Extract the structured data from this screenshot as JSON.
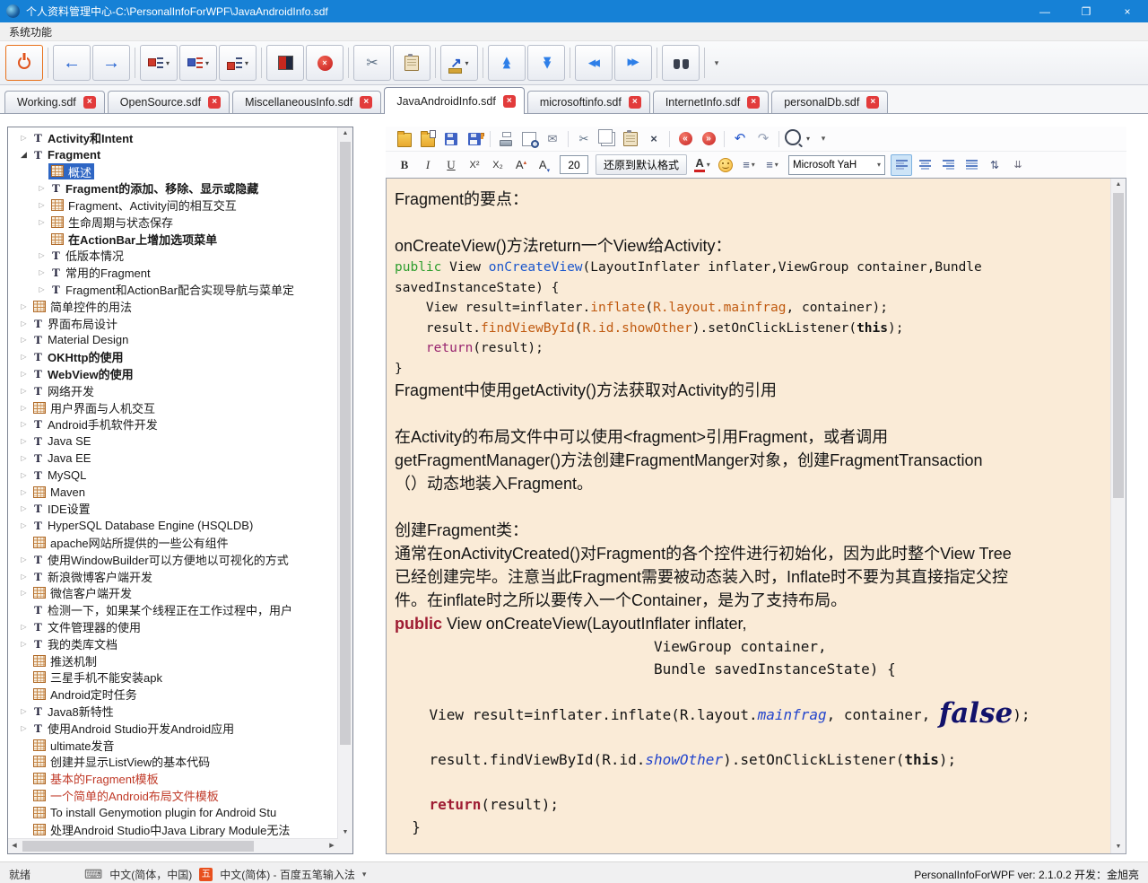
{
  "window": {
    "title": "个人资料管理中心-C:\\PersonalInfoForWPF\\JavaAndroidInfo.sdf",
    "menu": [
      "系统功能"
    ],
    "controls": {
      "minimize": "—",
      "maximize": "❐",
      "close": "×"
    }
  },
  "colors": {
    "titlebar": "#1681D6",
    "editor_background": "#FAEBD7",
    "tree_selection": "#2E66C4",
    "tab_close_red": "#E23B3B",
    "tree_red_item": "#C03A28"
  },
  "toolbar": {
    "groups": [
      [
        {
          "name": "power-button",
          "icon": "power",
          "cls": "power"
        }
      ],
      [
        {
          "name": "back-button",
          "icon": "arrow-left",
          "glyph": "←"
        },
        {
          "name": "forward-button",
          "icon": "arrow-right",
          "glyph": "→"
        }
      ],
      [
        {
          "name": "tree-style-dropdown",
          "icon": "tree1",
          "dropdown": true
        },
        {
          "name": "tree-expand-dropdown",
          "icon": "tree2",
          "dropdown": true
        },
        {
          "name": "tree-collapse-dropdown",
          "icon": "tree3",
          "dropdown": true
        }
      ],
      [
        {
          "name": "mark-node-button",
          "icon": "flag"
        },
        {
          "name": "delete-node-button",
          "icon": "stop",
          "glyph": "×"
        }
      ],
      [
        {
          "name": "cut-node-button",
          "icon": "scissors",
          "glyph": "✂"
        },
        {
          "name": "paste-node-button",
          "icon": "clipboard"
        }
      ],
      [
        {
          "name": "export-button",
          "icon": "export",
          "glyph": "↗",
          "dropdown": true
        }
      ],
      [
        {
          "name": "move-up-button",
          "icon": "double-up",
          "glyph": "▶▶"
        },
        {
          "name": "move-down-button",
          "icon": "double-down",
          "glyph": "▶▶"
        }
      ],
      [
        {
          "name": "prev-node-button",
          "icon": "double-left",
          "glyph": "▶▶"
        },
        {
          "name": "next-node-button",
          "icon": "double-right",
          "glyph": "▶▶"
        }
      ],
      [
        {
          "name": "search-button",
          "icon": "binoculars"
        }
      ],
      [
        {
          "name": "toolbar-overflow-button",
          "icon": "overflow",
          "glyph": "▾",
          "flat": true
        }
      ]
    ]
  },
  "tabs": [
    {
      "label": "Working.sdf",
      "active": false
    },
    {
      "label": "OpenSource.sdf",
      "active": false
    },
    {
      "label": "MiscellaneousInfo.sdf",
      "active": false
    },
    {
      "label": "JavaAndroidInfo.sdf",
      "active": true
    },
    {
      "label": "microsoftinfo.sdf",
      "active": false
    },
    {
      "label": "InternetInfo.sdf",
      "active": false
    },
    {
      "label": "personalDb.sdf",
      "active": false
    }
  ],
  "tree": {
    "items": [
      {
        "label": "Activity和Intent",
        "icon": "T",
        "lvl": 0,
        "ar": "c",
        "b": true
      },
      {
        "label": "Fragment",
        "icon": "T",
        "lvl": 0,
        "ar": "e",
        "b": true
      },
      {
        "label": "概述",
        "icon": "g",
        "lvl": 1,
        "ar": "n",
        "sel": true
      },
      {
        "label": "Fragment的添加、移除、显示或隐藏",
        "icon": "T",
        "lvl": 1,
        "ar": "c",
        "b": true
      },
      {
        "label": "Fragment、Activity间的相互交互",
        "icon": "g",
        "lvl": 1,
        "ar": "c"
      },
      {
        "label": "生命周期与状态保存",
        "icon": "g",
        "lvl": 1,
        "ar": "c"
      },
      {
        "label": "在ActionBar上增加选项菜单",
        "icon": "g",
        "lvl": 1,
        "ar": "n",
        "b": true
      },
      {
        "label": "低版本情况",
        "icon": "T",
        "lvl": 1,
        "ar": "c"
      },
      {
        "label": "常用的Fragment",
        "icon": "T",
        "lvl": 1,
        "ar": "c"
      },
      {
        "label": "Fragment和ActionBar配合实现导航与菜单定",
        "icon": "T",
        "lvl": 1,
        "ar": "c"
      },
      {
        "label": "简单控件的用法",
        "icon": "g",
        "lvl": 0,
        "ar": "c"
      },
      {
        "label": "界面布局设计",
        "icon": "T",
        "lvl": 0,
        "ar": "c"
      },
      {
        "label": "Material Design",
        "icon": "T",
        "lvl": 0,
        "ar": "c"
      },
      {
        "label": "OKHttp的使用",
        "icon": "T",
        "lvl": 0,
        "ar": "c",
        "b": true
      },
      {
        "label": "WebView的使用",
        "icon": "T",
        "lvl": 0,
        "ar": "c",
        "b": true
      },
      {
        "label": "网络开发",
        "icon": "T",
        "lvl": 0,
        "ar": "c"
      },
      {
        "label": "用户界面与人机交互",
        "icon": "g",
        "lvl": 0,
        "ar": "c"
      },
      {
        "label": "Android手机软件开发",
        "icon": "T",
        "lvl": 0,
        "ar": "c"
      },
      {
        "label": "Java SE",
        "icon": "T",
        "lvl": 0,
        "ar": "c"
      },
      {
        "label": "Java EE",
        "icon": "T",
        "lvl": 0,
        "ar": "c"
      },
      {
        "label": "MySQL",
        "icon": "T",
        "lvl": 0,
        "ar": "c"
      },
      {
        "label": "Maven",
        "icon": "g",
        "lvl": 0,
        "ar": "c"
      },
      {
        "label": "IDE设置",
        "icon": "T",
        "lvl": 0,
        "ar": "c"
      },
      {
        "label": "HyperSQL Database Engine (HSQLDB)",
        "icon": "T",
        "lvl": 0,
        "ar": "c"
      },
      {
        "label": "apache网站所提供的一些公有组件",
        "icon": "g",
        "lvl": 0,
        "ar": "n"
      },
      {
        "label": "使用WindowBuilder可以方便地以可视化的方式",
        "icon": "T",
        "lvl": 0,
        "ar": "c"
      },
      {
        "label": "新浪微博客户端开发",
        "icon": "T",
        "lvl": 0,
        "ar": "c"
      },
      {
        "label": "微信客户端开发",
        "icon": "g",
        "lvl": 0,
        "ar": "c"
      },
      {
        "label": "检测一下，如果某个线程正在工作过程中，用户",
        "icon": "T",
        "lvl": 0,
        "ar": "n"
      },
      {
        "label": "文件管理器的使用",
        "icon": "T",
        "lvl": 0,
        "ar": "c"
      },
      {
        "label": "我的类库文档",
        "icon": "T",
        "lvl": 0,
        "ar": "c"
      },
      {
        "label": "推送机制",
        "icon": "g",
        "lvl": 0,
        "ar": "n"
      },
      {
        "label": "三星手机不能安装apk",
        "icon": "g",
        "lvl": 0,
        "ar": "n"
      },
      {
        "label": "Android定时任务",
        "icon": "g",
        "lvl": 0,
        "ar": "n"
      },
      {
        "label": "Java8新特性",
        "icon": "T",
        "lvl": 0,
        "ar": "c"
      },
      {
        "label": "使用Android Studio开发Android应用",
        "icon": "T",
        "lvl": 0,
        "ar": "c"
      },
      {
        "label": "ultimate发音",
        "icon": "g",
        "lvl": 0,
        "ar": "n"
      },
      {
        "label": "创建并显示ListView的基本代码",
        "icon": "g",
        "lvl": 0,
        "ar": "n"
      },
      {
        "label": "基本的Fragment模板",
        "icon": "g",
        "lvl": 0,
        "ar": "n",
        "red": true
      },
      {
        "label": "一个简单的Android布局文件模板",
        "icon": "g",
        "lvl": 0,
        "ar": "n",
        "red": true
      },
      {
        "label": "To install Genymotion plugin for Android Stu",
        "icon": "g",
        "lvl": 0,
        "ar": "n"
      },
      {
        "label": "处理Android Studio中Java Library Module无法",
        "icon": "g",
        "lvl": 0,
        "ar": "n"
      }
    ]
  },
  "editor": {
    "toolbar1": {
      "groups": [
        [
          {
            "name": "open-button",
            "icon": "folder-open"
          },
          {
            "name": "open-in-window-button",
            "icon": "folder-doc"
          },
          {
            "name": "save-button",
            "icon": "floppy"
          },
          {
            "name": "save-as-button",
            "icon": "floppy-edit"
          }
        ],
        [
          {
            "name": "print-button",
            "icon": "printer"
          },
          {
            "name": "print-preview-button",
            "icon": "preview"
          },
          {
            "name": "email-button",
            "icon": "envelope",
            "glyph": "✉"
          }
        ],
        [
          {
            "name": "cut-button",
            "icon": "scissors-sm",
            "glyph": "✂"
          },
          {
            "name": "copy-button",
            "icon": "copy-pages"
          },
          {
            "name": "paste-button",
            "icon": "clipboard-sm"
          },
          {
            "name": "delete-button",
            "icon": "delete-x",
            "glyph": "×"
          }
        ],
        [
          {
            "name": "nav-first-button",
            "icon": "red-first",
            "glyph": "«"
          },
          {
            "name": "nav-last-button",
            "icon": "red-last",
            "glyph": "»"
          }
        ],
        [
          {
            "name": "undo-button",
            "icon": "undo",
            "glyph": "↶"
          },
          {
            "name": "redo-button",
            "icon": "redo",
            "glyph": "↷"
          }
        ],
        [
          {
            "name": "zoom-button",
            "icon": "magnifier",
            "dropdown": true
          },
          {
            "name": "editor-toolbar-overflow-button",
            "icon": "overflow",
            "glyph": "▾",
            "flat": true
          }
        ]
      ]
    },
    "toolbar2": {
      "bold": "B",
      "italic": "I",
      "underline": "U",
      "superscript": "X²",
      "subscript": "X₂",
      "grow_font": "A",
      "shrink_font": "A",
      "font_size": "20",
      "restore_format": "还原到默认格式",
      "font_color": "A",
      "font_family": "Microsoft YaH"
    },
    "content": {
      "lines": [
        {
          "f": "s",
          "seg": [
            [
              "Fragment的要点：",
              ""
            ]
          ]
        },
        {
          "f": "s",
          "seg": []
        },
        {
          "f": "s",
          "seg": [
            [
              "onCreateView()方法return一个View给Activity：",
              ""
            ]
          ]
        },
        {
          "f": "c1",
          "seg": [
            [
              "public",
              "kg"
            ],
            [
              " View ",
              ""
            ],
            [
              "onCreateView",
              "kb"
            ],
            [
              "(LayoutInflater inflater,ViewGroup container,Bundle",
              ""
            ]
          ]
        },
        {
          "f": "c1",
          "seg": [
            [
              "savedInstanceState) {",
              ""
            ]
          ]
        },
        {
          "f": "c1",
          "seg": [
            [
              "    View result=inflater.",
              ""
            ],
            [
              "inflate",
              "ko"
            ],
            [
              "(",
              ""
            ],
            [
              "R.layout.mainfrag",
              "ko"
            ],
            [
              ", container);",
              ""
            ]
          ]
        },
        {
          "f": "c1",
          "seg": [
            [
              "    result.",
              ""
            ],
            [
              "findViewById",
              "ko"
            ],
            [
              "(",
              ""
            ],
            [
              "R.id.showOther",
              "ko"
            ],
            [
              ").setOnClickListener(",
              ""
            ],
            [
              "this",
              "kbd"
            ],
            [
              ");",
              ""
            ]
          ]
        },
        {
          "f": "c1",
          "seg": [
            [
              "    ",
              ""
            ],
            [
              "return",
              "km"
            ],
            [
              "(result);",
              ""
            ]
          ]
        },
        {
          "f": "c1",
          "seg": [
            [
              "}",
              ""
            ]
          ]
        },
        {
          "f": "s",
          "seg": [
            [
              "Fragment中使用getActivity()方法获取对Activity的引用",
              ""
            ]
          ]
        },
        {
          "f": "s",
          "seg": []
        },
        {
          "f": "s",
          "seg": [
            [
              "在Activity的布局文件中可以使用<fragment>引用Fragment，或者调用",
              ""
            ]
          ]
        },
        {
          "f": "s",
          "seg": [
            [
              "getFragmentManager()方法创建FragmentManger对象，创建FragmentTransaction",
              ""
            ]
          ]
        },
        {
          "f": "s",
          "seg": [
            [
              "（）动态地装入Fragment。",
              ""
            ]
          ]
        },
        {
          "f": "s",
          "seg": []
        },
        {
          "f": "s",
          "seg": [
            [
              "创建Fragment类：",
              ""
            ]
          ]
        },
        {
          "f": "s",
          "seg": [
            [
              "通常在onActivityCreated()对Fragment的各个控件进行初始化，因为此时整个View Tree",
              ""
            ]
          ]
        },
        {
          "f": "s",
          "seg": [
            [
              "已经创建完毕。注意当此Fragment需要被动态装入时，Inflate时不要为其直接指定父控",
              ""
            ]
          ]
        },
        {
          "f": "s",
          "seg": [
            [
              "件。在inflate时之所以要传入一个Container，是为了支持布局。",
              ""
            ]
          ]
        },
        {
          "f": "s",
          "seg": [
            [
              "public",
              "kw2"
            ],
            [
              " View onCreateView(LayoutInflater inflater,",
              ""
            ]
          ]
        },
        {
          "f": "c2",
          "seg": [
            [
              "                              ViewGroup container,",
              ""
            ]
          ]
        },
        {
          "f": "c2",
          "seg": [
            [
              "                              Bundle savedInstanceState) {",
              ""
            ]
          ]
        },
        {
          "f": "c2",
          "seg": []
        },
        {
          "f": "c2",
          "seg": [
            [
              "    View result=inflater.inflate(R.layout.",
              ""
            ],
            [
              "mainfrag",
              "kit"
            ],
            [
              ", container, ",
              ""
            ],
            [
              "false",
              "kfalse"
            ],
            [
              ");",
              ""
            ]
          ]
        },
        {
          "f": "c2",
          "seg": []
        },
        {
          "f": "c2",
          "seg": [
            [
              "    result.findViewById(R.id.",
              ""
            ],
            [
              "showOther",
              "kit"
            ],
            [
              ").setOnClickListener(",
              ""
            ],
            [
              "this",
              "kbd"
            ],
            [
              ");",
              ""
            ]
          ]
        },
        {
          "f": "c2",
          "seg": []
        },
        {
          "f": "c2",
          "seg": [
            [
              "    ",
              ""
            ],
            [
              "return",
              "kw2"
            ],
            [
              "(result);",
              ""
            ]
          ]
        },
        {
          "f": "c2",
          "seg": [
            [
              "  }",
              ""
            ]
          ]
        }
      ]
    }
  },
  "statusbar": {
    "ready": "就绪",
    "language": "中文(简体，中国)",
    "ime": "中文(简体) - 百度五笔输入法",
    "ime_icon_label": "五",
    "version": "PersonalInfoForWPF ver: 2.1.0.2 开发：金旭亮"
  }
}
